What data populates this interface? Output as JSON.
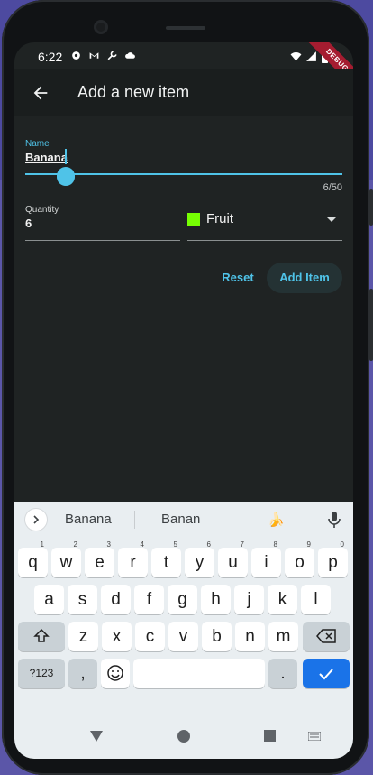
{
  "status_bar": {
    "time": "6:22",
    "debug_label": "DEBUG"
  },
  "app_bar": {
    "title": "Add a new item"
  },
  "form": {
    "name_label": "Name",
    "name_value": "Banana",
    "name_counter": "6/50",
    "quantity_label": "Quantity",
    "quantity_value": "6",
    "category_value": "Fruit",
    "category_color": "#76ff03",
    "reset_label": "Reset",
    "add_label": "Add Item"
  },
  "keyboard": {
    "suggestions": [
      "Banana",
      "Banan",
      "🍌"
    ],
    "row1": [
      [
        "q",
        "1"
      ],
      [
        "w",
        "2"
      ],
      [
        "e",
        "3"
      ],
      [
        "r",
        "4"
      ],
      [
        "t",
        "5"
      ],
      [
        "y",
        "6"
      ],
      [
        "u",
        "7"
      ],
      [
        "i",
        "8"
      ],
      [
        "o",
        "9"
      ],
      [
        "p",
        "0"
      ]
    ],
    "row2": [
      "a",
      "s",
      "d",
      "f",
      "g",
      "h",
      "j",
      "k",
      "l"
    ],
    "row3": [
      "z",
      "x",
      "c",
      "v",
      "b",
      "n",
      "m"
    ],
    "symbols_label": "?123",
    "comma_label": ",",
    "period_label": "."
  },
  "colors": {
    "accent": "#4fc3e8",
    "background": "#1f2323"
  }
}
